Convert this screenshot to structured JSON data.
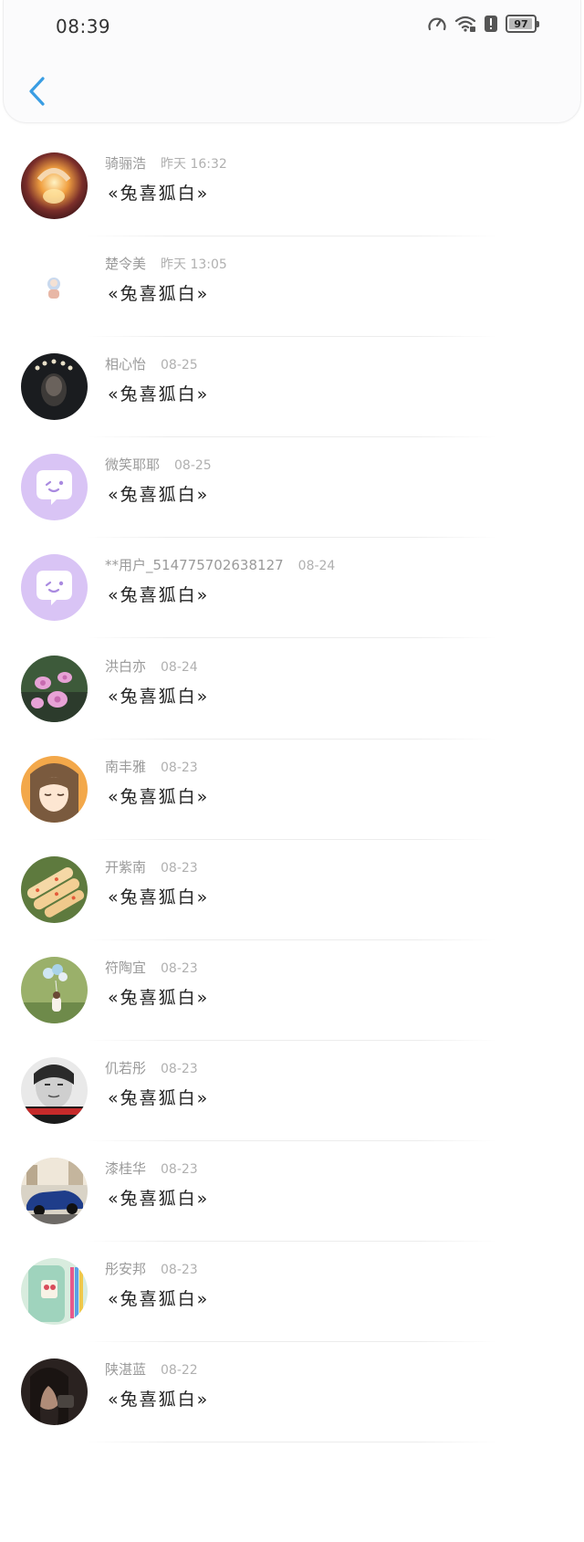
{
  "status_bar": {
    "time": "08:39",
    "battery": "97",
    "battery_level_percent": 97,
    "icons": [
      "speedometer-icon",
      "wifi-icon",
      "alert-icon",
      "battery-icon"
    ]
  },
  "header": {
    "back_icon": "chevron-left-icon",
    "accent_color": "#3a9de3"
  },
  "items": [
    {
      "name": "骑骊浩",
      "time": "昨天 16:32",
      "title": "«兔喜狐白»",
      "avatar": "fire-hands"
    },
    {
      "name": "楚令美",
      "time": "昨天 13:05",
      "title": "«兔喜狐白»",
      "avatar": "small-figure"
    },
    {
      "name": "相心怡",
      "time": "08-25",
      "title": "«兔喜狐白»",
      "avatar": "dark-portrait"
    },
    {
      "name": "微笑耶耶",
      "time": "08-25",
      "title": "«兔喜狐白»",
      "avatar": "default-chat"
    },
    {
      "name": "**用户_514775702638127",
      "time": "08-24",
      "title": "«兔喜狐白»",
      "avatar": "default-chat"
    },
    {
      "name": "洪白亦",
      "time": "08-24",
      "title": "«兔喜狐白»",
      "avatar": "orchid"
    },
    {
      "name": "南丰雅",
      "time": "08-23",
      "title": "«兔喜狐白»",
      "avatar": "anime-girl"
    },
    {
      "name": "开紫南",
      "time": "08-23",
      "title": "«兔喜狐白»",
      "avatar": "food-rolls"
    },
    {
      "name": "符陶宜",
      "time": "08-23",
      "title": "«兔喜狐白»",
      "avatar": "park-balloons"
    },
    {
      "name": "仉若彤",
      "time": "08-23",
      "title": "«兔喜狐白»",
      "avatar": "bw-face"
    },
    {
      "name": "漆桂华",
      "time": "08-23",
      "title": "«兔喜狐白»",
      "avatar": "blue-car"
    },
    {
      "name": "彤安邦",
      "time": "08-23",
      "title": "«兔喜狐白»",
      "avatar": "phone-case"
    },
    {
      "name": "陕湛蓝",
      "time": "08-22",
      "title": "«兔喜狐白»",
      "avatar": "dark-selfie"
    }
  ]
}
